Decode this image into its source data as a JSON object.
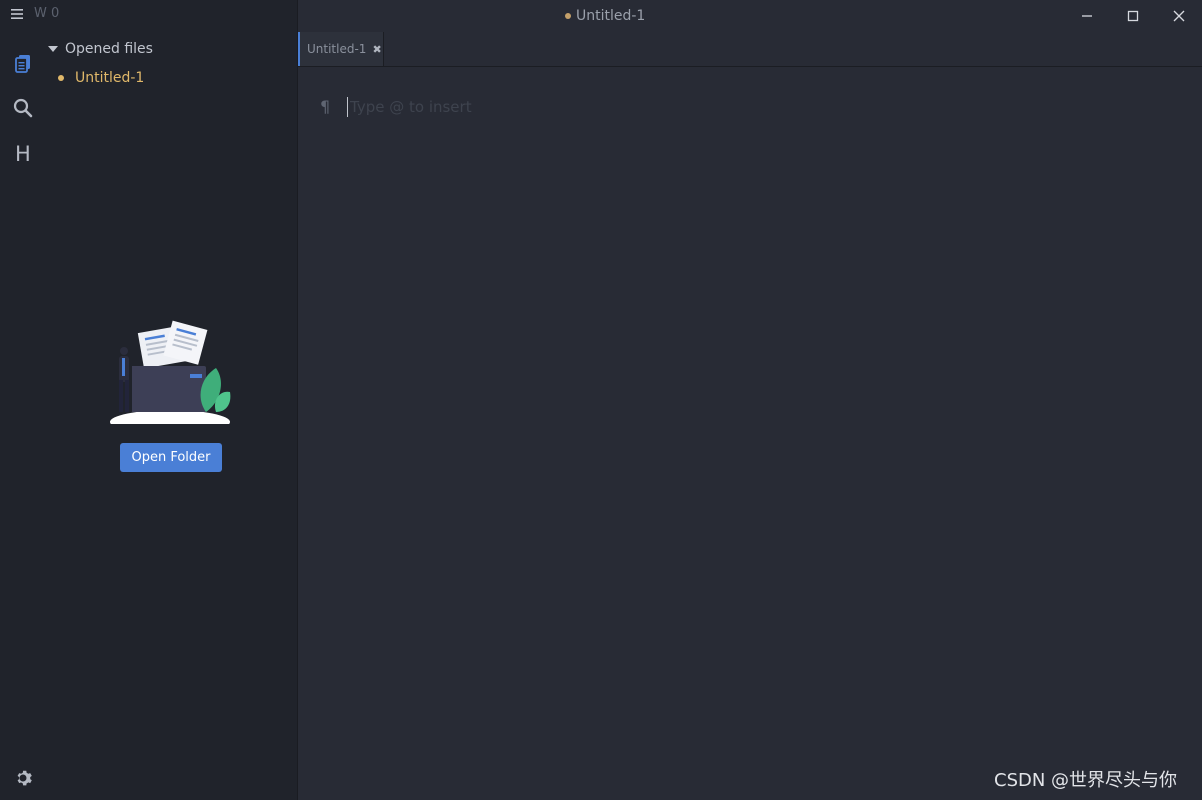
{
  "titlebar": {
    "word_count": "W 0",
    "document_title": "Untitled-1",
    "icons": [
      "menu-icon",
      "minimize-icon",
      "maximize-icon",
      "close-icon"
    ]
  },
  "activity_bar": {
    "items": [
      "files-icon",
      "search-icon",
      "toc-heading-icon"
    ],
    "toc_letter": "H",
    "settings": "gear-icon"
  },
  "sidebar": {
    "section_title": "Opened files",
    "files": [
      {
        "name": "Untitled-1",
        "unsaved": true
      }
    ],
    "open_folder_label": "Open Folder"
  },
  "tabs": [
    {
      "label": "Untitled-1",
      "close": "✖"
    }
  ],
  "editor": {
    "pilcrow": "¶",
    "placeholder": "Type @ to insert"
  },
  "watermark": "CSDN @世界尽头与你",
  "colors": {
    "accent": "#4a7fd6",
    "unsaved": "#e0b86a",
    "sidebar_bg": "#20232b",
    "editor_bg": "#282b35"
  }
}
